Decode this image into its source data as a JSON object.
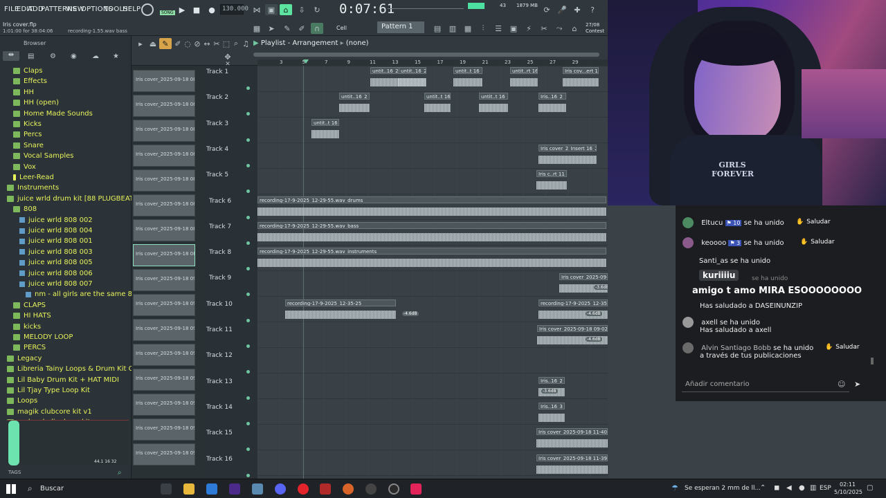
{
  "menu": [
    "FILE",
    "EDIT",
    "ADD",
    "PATTERNS",
    "VIEW",
    "OPTIONS",
    "TOOLS",
    "HELP"
  ],
  "project": {
    "name": "Iris cover.flp",
    "time_info": "1:01:00 for 38:04:06",
    "hint": "recording-1.55.wav bass"
  },
  "transport": {
    "tempo": "130.000",
    "song_label": "SONG",
    "time": "0:07:61",
    "mem": "1879 MB",
    "cpu": "43",
    "date_right": "27/08",
    "news_label": "Contest"
  },
  "toolbar": {
    "snap_label": "Cell",
    "pattern": "Pattern 1"
  },
  "browser": {
    "title": "Browser",
    "items": [
      {
        "label": "Claps",
        "type": "folder",
        "indent": 1
      },
      {
        "label": "Effects",
        "type": "folder",
        "indent": 1
      },
      {
        "label": "HH",
        "type": "folder",
        "indent": 1
      },
      {
        "label": "HH (open)",
        "type": "folder",
        "indent": 1
      },
      {
        "label": "Home Made Sounds",
        "type": "folder",
        "indent": 1
      },
      {
        "label": "Kicks",
        "type": "folder",
        "indent": 1
      },
      {
        "label": "Percs",
        "type": "folder",
        "indent": 1
      },
      {
        "label": "Snare",
        "type": "folder",
        "indent": 1
      },
      {
        "label": "Vocal Samples",
        "type": "folder",
        "indent": 1
      },
      {
        "label": "Vox",
        "type": "folder",
        "indent": 1
      },
      {
        "label": "Leer-Read",
        "type": "file",
        "indent": 1
      },
      {
        "label": "Instruments",
        "type": "folder",
        "indent": 0
      },
      {
        "label": "juice wrld drum kit [88 PLUGBEATS]",
        "type": "folder",
        "indent": 0
      },
      {
        "label": "808",
        "type": "folder",
        "indent": 1
      },
      {
        "label": "juice wrld 808 002",
        "type": "kit",
        "indent": 2
      },
      {
        "label": "juice wrld  808 004",
        "type": "kit",
        "indent": 2
      },
      {
        "label": "juice wrld 808 001",
        "type": "kit",
        "indent": 2
      },
      {
        "label": "juice wrld 808 003",
        "type": "kit",
        "indent": 2
      },
      {
        "label": "juice wrld 808 005",
        "type": "kit",
        "indent": 2
      },
      {
        "label": "juice wrld 808 006",
        "type": "kit",
        "indent": 2
      },
      {
        "label": "juice wrld 808 007",
        "type": "kit",
        "indent": 2
      },
      {
        "label": "nm - all girls are the same 808",
        "type": "kit",
        "indent": 3
      },
      {
        "label": "CLAPS",
        "type": "folder",
        "indent": 1
      },
      {
        "label": "HI HATS",
        "type": "folder",
        "indent": 1
      },
      {
        "label": "kicks",
        "type": "folder",
        "indent": 1
      },
      {
        "label": "MELODY LOOP",
        "type": "folder",
        "indent": 1
      },
      {
        "label": "PERCS",
        "type": "folder",
        "indent": 1
      },
      {
        "label": "Legacy",
        "type": "folder",
        "indent": 0
      },
      {
        "label": "Libreria Tainy Loops & Drum Kit Official",
        "type": "folder",
        "indent": 0
      },
      {
        "label": "Lil Baby Drum Kit + HAT MIDI",
        "type": "folder",
        "indent": 0
      },
      {
        "label": "Lil Tjay Type Loop Kit",
        "type": "folder",
        "indent": 0
      },
      {
        "label": "Loops",
        "type": "folder",
        "indent": 0
      },
      {
        "label": "magik clubcore kit v1",
        "type": "folder",
        "indent": 0
      },
      {
        "label": "melancholic drum kit",
        "type": "folder",
        "indent": 0
      }
    ],
    "sample_info": "44.1 16 32",
    "tags_label": "TAGS"
  },
  "thumbs": [
    "Iris cover_2025-09-18 08...",
    "Iris cover_2025-09-18 08...",
    "Iris cover_2025-09-18 08...",
    "Iris cover_2025-09-18 08...",
    "Iris cover_2025-09-18 08...",
    "Iris cover_2025-09-18 08...",
    "Iris cover_2025-09-18 08...",
    "Iris cover_2025-09-18 08...",
    "Iris cover_2025-09-18 09...",
    "Iris cover_2025-09-18 09...",
    "Iris cover_2025-09-18 09...",
    "Iris cover_2025-09-18 09...",
    "Iris cover_2025-09-18 09...",
    "Iris cover_2025-09-18 09...",
    "Iris cover_2025-09-18 09...",
    "Iris cover_2025-09-18 09..."
  ],
  "playlist": {
    "title": "Playlist - Arrangement",
    "pattern_name": "(none)",
    "ruler": [
      "3",
      "5",
      "7",
      "9",
      "11",
      "13",
      "15",
      "17",
      "19",
      "21",
      "23",
      "25",
      "27",
      "29"
    ],
    "tracks": [
      "Track 1",
      "Track 2",
      "Track 3",
      "Track 4",
      "Track 5",
      "Track 6",
      "Track 7",
      "Track 8",
      "Track 9",
      "Track 10",
      "Track 11",
      "Track 12",
      "Track 13",
      "Track 14",
      "Track 15",
      "Track 16"
    ],
    "clips": {
      "c1a": "untit..16_2",
      "c1b": "untit..16_2",
      "c1c": "untit..t 16",
      "c1d": "untit..rt 16",
      "c1e": "Iris cov...ert 16",
      "c2a": "untit..16_2",
      "c2b": "untit..t 16",
      "c2c": "untit..t 16",
      "c2d": "Iris..16_2",
      "c3a": "untit..t 16",
      "c4a": "Iris cover_2_Insert 16_2",
      "c5a": "Iris c..rt 11",
      "c6": "recording-17-9-2025_12-29-55.wav_drums",
      "c7": "recording-17-9-2025_12-29-55.wav_bass",
      "c8": "recording-17-9-2025_12-29-55.wav_instruments",
      "c9": "Iris cover_2025-09-18 09-01-24_Insert 11",
      "c10a": "recording-17-9-2025_12-35-25",
      "c10b": "recording-17-9-2025_12-35-25",
      "c11": "Iris cover_2025-09-18 09-02-22_Insert 10",
      "c13": "Iris..16_2",
      "c14": "Iris..16_3",
      "c15": "Iris cover_2025-09-18 11-40-36_Insert 23",
      "c16": "Iris cover_2025-09-18 11-39-42_Insert 22",
      "gain_a": "-3.6dB",
      "gain_b": "-4.6dB",
      "gain_c": "-4.6dB",
      "gain_d": "-4.6dB",
      "gain_e": "-3.6dB"
    }
  },
  "webcam": {
    "shirt_text": "GIRLS FOREVER"
  },
  "chat": {
    "messages": [
      {
        "user": "Eltucu",
        "badge": "10",
        "text": "se ha unido",
        "action": "Saludar"
      },
      {
        "user": "keoooo",
        "badge": "3",
        "text": "se ha unido",
        "action": "Saludar"
      },
      {
        "user": "Santi_as",
        "text": "se ha unido"
      },
      {
        "user": "kuriiiiu",
        "text": "amigo t amo MIRA ESOOOOOOOO",
        "extra": "se ha unido"
      },
      {
        "user": "",
        "text": "Has saludado a DASEINUNZIP"
      },
      {
        "user": "axell",
        "text": "se ha unido"
      },
      {
        "user": "",
        "text": "Has saludado a axell"
      },
      {
        "user": "Alvin Santiago Bobb",
        "text": "se ha unido",
        "sub": "a través de tus publicaciones",
        "action": "Saludar"
      }
    ],
    "comment_placeholder": "Añadir comentario"
  },
  "taskbar": {
    "search": "Buscar",
    "weather": "Se esperan 2 mm de ll...",
    "lang": "ESP",
    "time": "02:11",
    "date": "5/10/2025"
  }
}
